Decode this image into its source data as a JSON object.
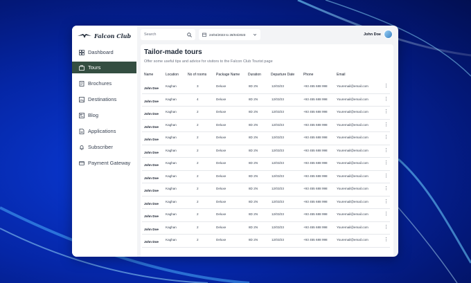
{
  "sidebar": {
    "logo_text": "Falcon Club",
    "items": [
      {
        "label": "Dashboard",
        "icon": "dashboard-icon"
      },
      {
        "label": "Tours",
        "icon": "tours-icon",
        "active": true
      },
      {
        "label": "Brochures",
        "icon": "brochure-icon"
      },
      {
        "label": "Destinations",
        "icon": "destinations-icon"
      },
      {
        "label": "Blog",
        "icon": "blog-icon"
      },
      {
        "label": "Applications",
        "icon": "applications-icon"
      },
      {
        "label": "Subscriber",
        "icon": "subscriber-icon"
      },
      {
        "label": "Payment Gateway",
        "icon": "payment-icon"
      }
    ]
  },
  "topbar": {
    "search_placeholder": "Search",
    "date_range": "24/04/2023 to 28/04/2023",
    "user_name": "John Doe"
  },
  "main": {
    "title": "Tailor-made tours",
    "subtitle": "Offer some useful tips and advice for visitors to the Falcon Club Tourist page",
    "columns": [
      "Name",
      "Location",
      "No of rooms",
      "Package Name",
      "Duration",
      "Departure Date",
      "Phone",
      "Email"
    ],
    "rows": [
      {
        "name": "John Doe",
        "location": "Kaghan",
        "rooms": "3",
        "package": "Deluxe",
        "duration": "8D 2N",
        "date": "12/03/23",
        "phone": "+93 455 688 998",
        "email": "Youremail@email.com"
      },
      {
        "name": "John Doe",
        "location": "Kaghan",
        "rooms": "4",
        "package": "Deluxe",
        "duration": "8D 2N",
        "date": "12/03/23",
        "phone": "+93 455 688 998",
        "email": "Youremail@email.com"
      },
      {
        "name": "John Doe",
        "location": "Kaghan",
        "rooms": "2",
        "package": "Deluxe",
        "duration": "8D 2N",
        "date": "12/03/23",
        "phone": "+93 455 688 998",
        "email": "Youremail@email.com"
      },
      {
        "name": "John Doe",
        "location": "Kaghan",
        "rooms": "2",
        "package": "Deluxe",
        "duration": "8D 2N",
        "date": "12/03/23",
        "phone": "+93 455 688 998",
        "email": "Youremail@email.com"
      },
      {
        "name": "John Doe",
        "location": "Kaghan",
        "rooms": "2",
        "package": "Deluxe",
        "duration": "8D 2N",
        "date": "12/03/23",
        "phone": "+93 455 688 998",
        "email": "Youremail@email.com"
      },
      {
        "name": "John Doe",
        "location": "Kaghan",
        "rooms": "2",
        "package": "Deluxe",
        "duration": "8D 2N",
        "date": "12/03/23",
        "phone": "+93 455 688 998",
        "email": "Youremail@email.com"
      },
      {
        "name": "John Doe",
        "location": "Kaghan",
        "rooms": "2",
        "package": "Deluxe",
        "duration": "8D 2N",
        "date": "12/03/23",
        "phone": "+93 455 688 998",
        "email": "Youremail@email.com"
      },
      {
        "name": "John Doe",
        "location": "Kaghan",
        "rooms": "2",
        "package": "Deluxe",
        "duration": "8D 2N",
        "date": "12/03/23",
        "phone": "+93 455 688 998",
        "email": "Youremail@email.com"
      },
      {
        "name": "John Doe",
        "location": "Kaghan",
        "rooms": "2",
        "package": "Deluxe",
        "duration": "8D 2N",
        "date": "12/03/23",
        "phone": "+93 455 688 998",
        "email": "Youremail@email.com"
      },
      {
        "name": "John Doe",
        "location": "Kaghan",
        "rooms": "2",
        "package": "Deluxe",
        "duration": "8D 2N",
        "date": "12/03/23",
        "phone": "+93 455 688 998",
        "email": "Youremail@email.com"
      },
      {
        "name": "John Doe",
        "location": "Kaghan",
        "rooms": "2",
        "package": "Deluxe",
        "duration": "8D 2N",
        "date": "12/03/23",
        "phone": "+93 455 688 998",
        "email": "Youremail@email.com"
      },
      {
        "name": "John Doe",
        "location": "Kaghan",
        "rooms": "2",
        "package": "Deluxe",
        "duration": "8D 2N",
        "date": "12/03/23",
        "phone": "+93 455 688 998",
        "email": "Youremail@email.com"
      },
      {
        "name": "John Doe",
        "location": "Kaghan",
        "rooms": "2",
        "package": "Deluxe",
        "duration": "8D 2N",
        "date": "12/03/23",
        "phone": "+93 455 688 998",
        "email": "Youremail@email.com"
      }
    ]
  },
  "colors": {
    "active_nav": "#344e41",
    "background_blue": "#0526a6"
  }
}
